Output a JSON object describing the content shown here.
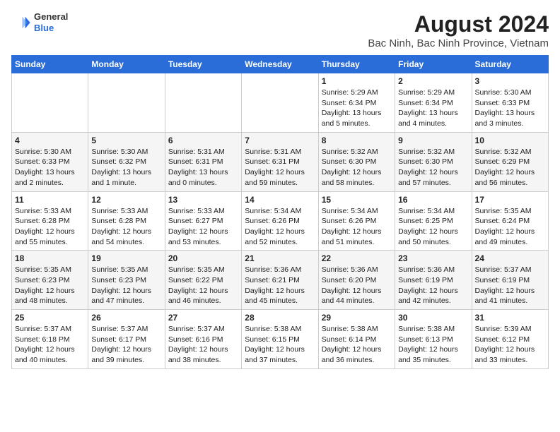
{
  "header": {
    "logo": {
      "general": "General",
      "blue": "Blue"
    },
    "title": "August 2024",
    "subtitle": "Bac Ninh, Bac Ninh Province, Vietnam"
  },
  "days_of_week": [
    "Sunday",
    "Monday",
    "Tuesday",
    "Wednesday",
    "Thursday",
    "Friday",
    "Saturday"
  ],
  "weeks": [
    [
      {
        "day": "",
        "info": ""
      },
      {
        "day": "",
        "info": ""
      },
      {
        "day": "",
        "info": ""
      },
      {
        "day": "",
        "info": ""
      },
      {
        "day": "1",
        "info": "Sunrise: 5:29 AM\nSunset: 6:34 PM\nDaylight: 13 hours\nand 5 minutes."
      },
      {
        "day": "2",
        "info": "Sunrise: 5:29 AM\nSunset: 6:34 PM\nDaylight: 13 hours\nand 4 minutes."
      },
      {
        "day": "3",
        "info": "Sunrise: 5:30 AM\nSunset: 6:33 PM\nDaylight: 13 hours\nand 3 minutes."
      }
    ],
    [
      {
        "day": "4",
        "info": "Sunrise: 5:30 AM\nSunset: 6:33 PM\nDaylight: 13 hours\nand 2 minutes."
      },
      {
        "day": "5",
        "info": "Sunrise: 5:30 AM\nSunset: 6:32 PM\nDaylight: 13 hours\nand 1 minute."
      },
      {
        "day": "6",
        "info": "Sunrise: 5:31 AM\nSunset: 6:31 PM\nDaylight: 13 hours\nand 0 minutes."
      },
      {
        "day": "7",
        "info": "Sunrise: 5:31 AM\nSunset: 6:31 PM\nDaylight: 12 hours\nand 59 minutes."
      },
      {
        "day": "8",
        "info": "Sunrise: 5:32 AM\nSunset: 6:30 PM\nDaylight: 12 hours\nand 58 minutes."
      },
      {
        "day": "9",
        "info": "Sunrise: 5:32 AM\nSunset: 6:30 PM\nDaylight: 12 hours\nand 57 minutes."
      },
      {
        "day": "10",
        "info": "Sunrise: 5:32 AM\nSunset: 6:29 PM\nDaylight: 12 hours\nand 56 minutes."
      }
    ],
    [
      {
        "day": "11",
        "info": "Sunrise: 5:33 AM\nSunset: 6:28 PM\nDaylight: 12 hours\nand 55 minutes."
      },
      {
        "day": "12",
        "info": "Sunrise: 5:33 AM\nSunset: 6:28 PM\nDaylight: 12 hours\nand 54 minutes."
      },
      {
        "day": "13",
        "info": "Sunrise: 5:33 AM\nSunset: 6:27 PM\nDaylight: 12 hours\nand 53 minutes."
      },
      {
        "day": "14",
        "info": "Sunrise: 5:34 AM\nSunset: 6:26 PM\nDaylight: 12 hours\nand 52 minutes."
      },
      {
        "day": "15",
        "info": "Sunrise: 5:34 AM\nSunset: 6:26 PM\nDaylight: 12 hours\nand 51 minutes."
      },
      {
        "day": "16",
        "info": "Sunrise: 5:34 AM\nSunset: 6:25 PM\nDaylight: 12 hours\nand 50 minutes."
      },
      {
        "day": "17",
        "info": "Sunrise: 5:35 AM\nSunset: 6:24 PM\nDaylight: 12 hours\nand 49 minutes."
      }
    ],
    [
      {
        "day": "18",
        "info": "Sunrise: 5:35 AM\nSunset: 6:23 PM\nDaylight: 12 hours\nand 48 minutes."
      },
      {
        "day": "19",
        "info": "Sunrise: 5:35 AM\nSunset: 6:23 PM\nDaylight: 12 hours\nand 47 minutes."
      },
      {
        "day": "20",
        "info": "Sunrise: 5:35 AM\nSunset: 6:22 PM\nDaylight: 12 hours\nand 46 minutes."
      },
      {
        "day": "21",
        "info": "Sunrise: 5:36 AM\nSunset: 6:21 PM\nDaylight: 12 hours\nand 45 minutes."
      },
      {
        "day": "22",
        "info": "Sunrise: 5:36 AM\nSunset: 6:20 PM\nDaylight: 12 hours\nand 44 minutes."
      },
      {
        "day": "23",
        "info": "Sunrise: 5:36 AM\nSunset: 6:19 PM\nDaylight: 12 hours\nand 42 minutes."
      },
      {
        "day": "24",
        "info": "Sunrise: 5:37 AM\nSunset: 6:19 PM\nDaylight: 12 hours\nand 41 minutes."
      }
    ],
    [
      {
        "day": "25",
        "info": "Sunrise: 5:37 AM\nSunset: 6:18 PM\nDaylight: 12 hours\nand 40 minutes."
      },
      {
        "day": "26",
        "info": "Sunrise: 5:37 AM\nSunset: 6:17 PM\nDaylight: 12 hours\nand 39 minutes."
      },
      {
        "day": "27",
        "info": "Sunrise: 5:37 AM\nSunset: 6:16 PM\nDaylight: 12 hours\nand 38 minutes."
      },
      {
        "day": "28",
        "info": "Sunrise: 5:38 AM\nSunset: 6:15 PM\nDaylight: 12 hours\nand 37 minutes."
      },
      {
        "day": "29",
        "info": "Sunrise: 5:38 AM\nSunset: 6:14 PM\nDaylight: 12 hours\nand 36 minutes."
      },
      {
        "day": "30",
        "info": "Sunrise: 5:38 AM\nSunset: 6:13 PM\nDaylight: 12 hours\nand 35 minutes."
      },
      {
        "day": "31",
        "info": "Sunrise: 5:39 AM\nSunset: 6:12 PM\nDaylight: 12 hours\nand 33 minutes."
      }
    ]
  ]
}
